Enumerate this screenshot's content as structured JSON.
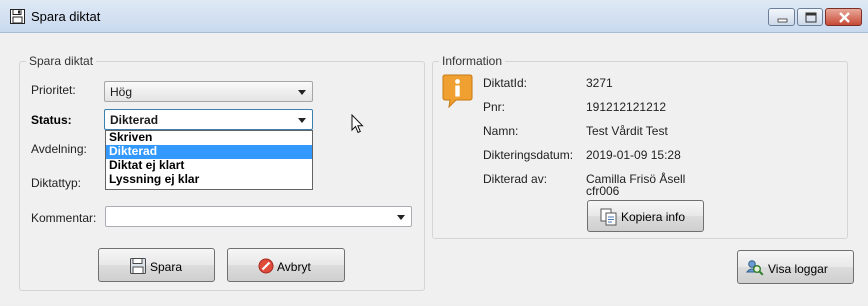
{
  "window": {
    "title": "Spara diktat"
  },
  "form": {
    "group_title": "Spara diktat",
    "prioritet_label": "Prioritet:",
    "prioritet_value": "Hög",
    "status_label": "Status:",
    "status_value": "Dikterad",
    "status_options": [
      "Skriven",
      "Dikterad",
      "Diktat ej klart",
      "Lyssning ej klar"
    ],
    "avdelning_label": "Avdelning:",
    "diktattyp_label": "Diktattyp:",
    "kommentar_label": "Kommentar:",
    "kommentar_value": "",
    "spara_label": "Spara",
    "avbryt_label": "Avbryt"
  },
  "info": {
    "group_title": "Information",
    "rows": [
      {
        "label": "DiktatId:",
        "value": "3271"
      },
      {
        "label": "Pnr:",
        "value": "191212121212"
      },
      {
        "label": "Namn:",
        "value": "Test Vårdit Test"
      },
      {
        "label": "Dikteringsdatum:",
        "value": "2019-01-09 15:28"
      },
      {
        "label": "Dikterad av:",
        "value": "Camilla Frisö Åsell"
      }
    ],
    "dikterad_av_id": "cfr006",
    "kopiera_label": "Kopiera info"
  },
  "footer": {
    "visa_loggar_label": "Visa loggar"
  },
  "icons": {
    "title": "save-icon",
    "info": "info-icon",
    "spara": "save-icon",
    "avbryt": "cancel-icon",
    "kopiera": "copy-icon",
    "visa_loggar": "search-user-icon"
  },
  "colors": {
    "selection": "#3399ff",
    "info_icon": "#f0a030",
    "close_button": "#c74a36",
    "title_bar": "#c9d9ee"
  }
}
